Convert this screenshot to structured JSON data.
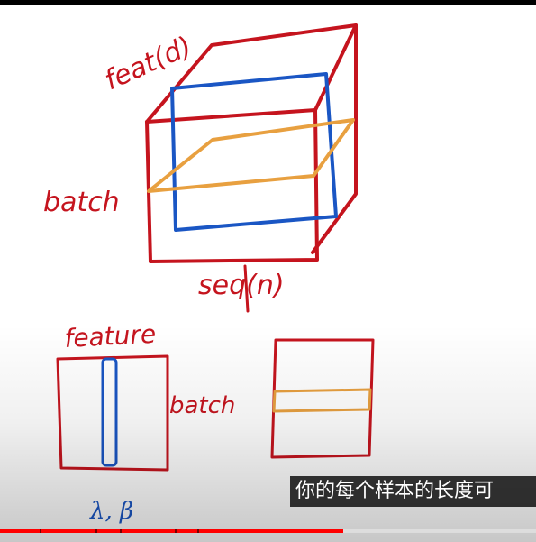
{
  "video": {
    "subtitle": "你的每个样本的长度可",
    "progress_fraction": 0.64
  },
  "labels": {
    "cube_feature": "feat(d)",
    "cube_batch": "batch",
    "cube_seq": "seq(n)",
    "layer_feature": "feature",
    "layer_batch": "batch",
    "layer_params": "λ, β"
  },
  "colors": {
    "ink_red": "#c5141e",
    "ink_blue": "#1a56c4",
    "ink_orange": "#e8a040",
    "progress": "#ff0000"
  }
}
